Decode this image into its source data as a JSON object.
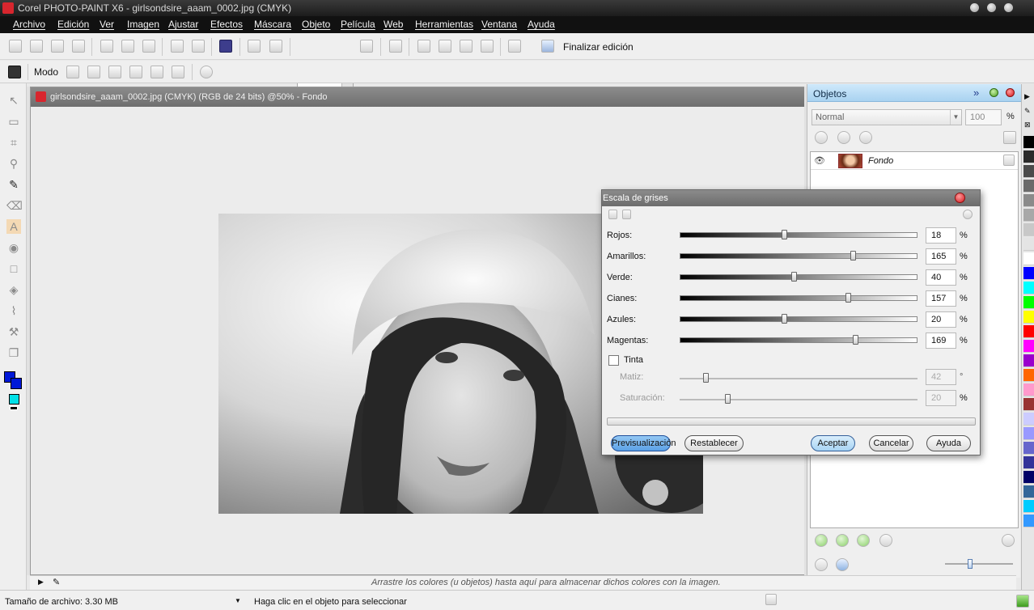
{
  "window": {
    "title": "Corel PHOTO-PAINT X6 - girlsondsire_aaam_0002.jpg (CMYK)"
  },
  "menu": [
    "Archivo",
    "Edición",
    "Ver",
    "Imagen",
    "Ajustar",
    "Efectos",
    "Máscara",
    "Objeto",
    "Película",
    "Web",
    "Herramientas",
    "Ventana",
    "Ayuda"
  ],
  "toolbar": {
    "zoom": "50%",
    "finish_edit": "Finalizar edición"
  },
  "property_bar": {
    "mode_label": "Modo"
  },
  "document": {
    "title": "girlsondsire_aaam_0002.jpg (CMYK) (RGB de 24 bits) @50% - Fondo"
  },
  "objects_panel": {
    "title": "Objetos",
    "blend_mode": "Normal",
    "opacity": "100",
    "opacity_unit": "%",
    "layer_name": "Fondo"
  },
  "dialog": {
    "title": "Escala de grises",
    "sliders": [
      {
        "label": "Rojos:",
        "value": "18",
        "pos": 0.44,
        "unit": "%"
      },
      {
        "label": "Amarillos:",
        "value": "165",
        "pos": 0.73,
        "unit": "%"
      },
      {
        "label": "Verde:",
        "value": "40",
        "pos": 0.48,
        "unit": "%"
      },
      {
        "label": "Cianes:",
        "value": "157",
        "pos": 0.71,
        "unit": "%"
      },
      {
        "label": "Azules:",
        "value": "20",
        "pos": 0.44,
        "unit": "%"
      },
      {
        "label": "Magentas:",
        "value": "169",
        "pos": 0.74,
        "unit": "%"
      }
    ],
    "tint": {
      "label": "Tinta",
      "checked": false,
      "hue_label": "Matiz:",
      "hue_value": "42",
      "hue_pos": 0.11,
      "hue_unit": "°",
      "sat_label": "Saturación:",
      "sat_value": "20",
      "sat_pos": 0.2,
      "sat_unit": "%"
    },
    "buttons": {
      "preview": "Previsualización",
      "reset": "Restablecer",
      "ok": "Aceptar",
      "cancel": "Cancelar",
      "help": "Ayuda"
    }
  },
  "hint_bar": "Arrastre los colores (u objetos) hasta aquí para almacenar dichos colores con la imagen.",
  "status": {
    "file_size": "Tamaño de archivo: 3.30 MB",
    "hint": "Haga clic en el objeto para seleccionar"
  },
  "colors": {
    "primary": "#0018d8",
    "secondary": "#00e0e8",
    "palette": [
      "#000000",
      "#2a2a2a",
      "#4a4a4a",
      "#6a6a6a",
      "#8a8a8a",
      "#a8a8a8",
      "#c8c8c8",
      "#e4e4e4",
      "#ffffff",
      "#0000ff",
      "#00ffff",
      "#00ff00",
      "#ffff00",
      "#ff0000",
      "#ff00ff",
      "#9900cc",
      "#ff6600",
      "#ff99cc",
      "#993333",
      "#ccccff",
      "#9999ff",
      "#6666cc",
      "#333399",
      "#000066",
      "#336699",
      "#00ccff",
      "#3399ff"
    ]
  }
}
